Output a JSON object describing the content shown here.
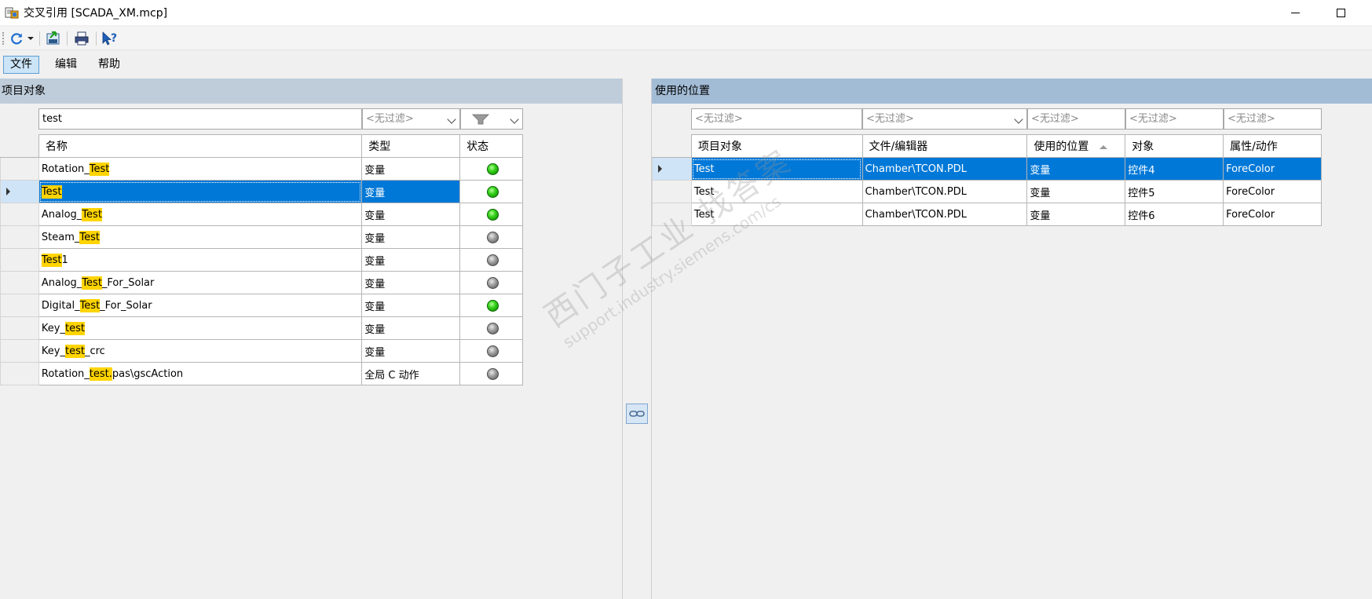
{
  "window": {
    "title": "交叉引用 [SCADA_XM.mcp]"
  },
  "toolbar": {
    "icons": [
      "refresh-icon",
      "dropdown-arrow-icon",
      "export-icon",
      "print-icon",
      "help-icon"
    ]
  },
  "menu": {
    "items": [
      {
        "label": "文件",
        "active": true
      },
      {
        "label": "编辑",
        "active": false
      },
      {
        "label": "帮助",
        "active": false
      }
    ]
  },
  "left": {
    "header": "项目对象",
    "filter": {
      "search_value": "test",
      "type_placeholder": "<无过滤>"
    },
    "columns": [
      "名称",
      "类型",
      "状态"
    ],
    "rows": [
      {
        "pre": "Rotation_",
        "hl": "Test",
        "post": "",
        "type": "变量",
        "status": "green",
        "selected": false
      },
      {
        "pre": "",
        "hl": "Test",
        "post": "",
        "type": "变量",
        "status": "green",
        "selected": true
      },
      {
        "pre": "Analog_",
        "hl": "Test",
        "post": "",
        "type": "变量",
        "status": "green",
        "selected": false
      },
      {
        "pre": "Steam_",
        "hl": "Test",
        "post": "",
        "type": "变量",
        "status": "gray",
        "selected": false
      },
      {
        "pre": "",
        "hl": "Test",
        "post": "1",
        "type": "变量",
        "status": "gray",
        "selected": false
      },
      {
        "pre": "Analog_",
        "hl": "Test",
        "post": "_For_Solar",
        "type": "变量",
        "status": "gray",
        "selected": false
      },
      {
        "pre": "Digital_",
        "hl": "Test",
        "post": "_For_Solar",
        "type": "变量",
        "status": "green",
        "selected": false
      },
      {
        "pre": "Key_",
        "hl": "test",
        "post": "",
        "type": "变量",
        "status": "gray",
        "selected": false
      },
      {
        "pre": "Key_",
        "hl": "test",
        "post": "_crc",
        "type": "变量",
        "status": "gray",
        "selected": false
      },
      {
        "pre": "Rotation_",
        "hl": "test.",
        "post": "pas\\gscAction",
        "type": "全局 C 动作",
        "status": "gray",
        "selected": false
      }
    ]
  },
  "right": {
    "header": "使用的位置",
    "filters": [
      "<无过滤>",
      "<无过滤>",
      "<无过滤>",
      "<无过滤>",
      "<无过滤>"
    ],
    "columns": [
      "项目对象",
      "文件/编辑器",
      "使用的位置",
      "对象",
      "属性/动作"
    ],
    "rows": [
      {
        "cells": [
          "Test",
          "Chamber\\TCON.PDL",
          "变量",
          "控件4",
          "ForeColor"
        ],
        "selected": true
      },
      {
        "cells": [
          "Test",
          "Chamber\\TCON.PDL",
          "变量",
          "控件5",
          "ForeColor"
        ],
        "selected": false
      },
      {
        "cells": [
          "Test",
          "Chamber\\TCON.PDL",
          "变量",
          "控件6",
          "ForeColor"
        ],
        "selected": false
      }
    ]
  },
  "watermark": {
    "line1": "西门子工业 找答案",
    "line2": "support.industry.siemens.com/cs"
  },
  "colors": {
    "selection": "#0078d7",
    "highlight": "#ffd400",
    "status_green": "#22c000",
    "status_gray": "#808080"
  }
}
